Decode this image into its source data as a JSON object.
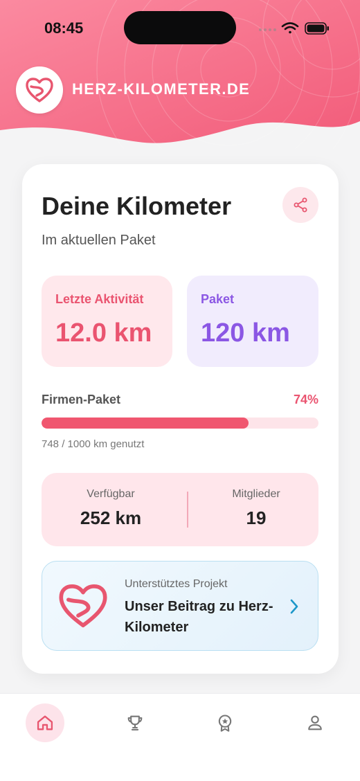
{
  "status_bar": {
    "time": "08:45"
  },
  "brand": {
    "name": "HERZ-KILOMETER.DE",
    "logo_icon": "heart-road-icon"
  },
  "card": {
    "title": "Deine Kilometer",
    "subtitle": "Im aktuellen Paket",
    "share_icon": "share-icon",
    "last_activity": {
      "label": "Letzte Aktivität",
      "value": "12.0 km"
    },
    "package": {
      "label": "Paket",
      "value": "120 km"
    },
    "company_package": {
      "label": "Firmen-Paket",
      "percent_text": "74%",
      "progress_fraction": 0.748,
      "caption": "748 / 1000 km genutzt"
    },
    "available": {
      "label": "Verfügbar",
      "value": "252 km"
    },
    "members": {
      "label": "Mitglieder",
      "value": "19"
    },
    "project": {
      "label": "Unterstütztes Projekt",
      "title": "Unser Beitrag zu Herz-Kilometer",
      "icon": "heart-road-icon"
    }
  },
  "tabbar": {
    "items": [
      {
        "icon": "home-icon",
        "active": true
      },
      {
        "icon": "trophy-icon",
        "active": false
      },
      {
        "icon": "award-badge-icon",
        "active": false
      },
      {
        "icon": "profile-icon",
        "active": false
      }
    ]
  },
  "colors": {
    "accent": "#ea5470",
    "purple": "#8b57e4",
    "header_gradient_start": "#fb7d95",
    "header_gradient_end": "#f25f7c"
  }
}
